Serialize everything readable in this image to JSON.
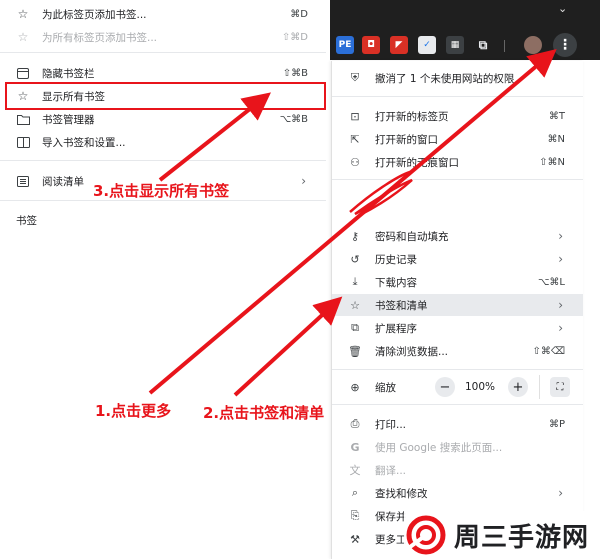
{
  "left_menu": {
    "items": [
      {
        "icon": "star-icon",
        "label": "为此标签页添加书签...",
        "shortcut": "⌘D",
        "disabled": false
      },
      {
        "icon": "star-icon",
        "label": "为所有标签页添加书签...",
        "shortcut": "⇧⌘D",
        "disabled": true
      },
      {
        "icon": "bookmark-bar-icon",
        "label": "隐藏书签栏",
        "shortcut": "⇧⌘B",
        "disabled": false
      },
      {
        "icon": "star-icon",
        "label": "显示所有书签",
        "shortcut": "",
        "disabled": false
      },
      {
        "icon": "folder-icon",
        "label": "书签管理器",
        "shortcut": "⌥⌘B",
        "disabled": false
      },
      {
        "icon": "import-icon",
        "label": "导入书签和设置...",
        "shortcut": "",
        "disabled": false
      },
      {
        "icon": "reading-list-icon",
        "label": "阅读清单",
        "shortcut": "",
        "disabled": false
      }
    ],
    "section_label": "书签"
  },
  "main_menu": {
    "notice": "撤消了 1 个未使用网站的权限",
    "new_items": [
      {
        "icon": "new-tab-icon",
        "label": "打开新的标签页",
        "shortcut": "⌘T"
      },
      {
        "icon": "new-window-icon",
        "label": "打开新的窗口",
        "shortcut": "⌘N"
      },
      {
        "icon": "incognito-icon",
        "label": "打开新的无痕窗口",
        "shortcut": "⇧⌘N"
      }
    ],
    "tool_items": [
      {
        "icon": "key-icon",
        "label": "密码和自动填充"
      },
      {
        "icon": "history-icon",
        "label": "历史记录"
      },
      {
        "icon": "download-icon",
        "label": "下载内容",
        "shortcut": "⌥⌘L"
      },
      {
        "icon": "star-icon",
        "label": "书签和清单"
      },
      {
        "icon": "puzzle-icon",
        "label": "扩展程序"
      },
      {
        "icon": "trash-icon",
        "label": "清除浏览数据...",
        "shortcut": "⇧⌘⌫"
      }
    ],
    "zoom": {
      "label": "缩放",
      "value": "100%"
    },
    "page_items": [
      {
        "icon": "print-icon",
        "label": "打印...",
        "shortcut": "⌘P",
        "disabled": false
      },
      {
        "icon": "google-icon",
        "label": "使用 Google 搜索此页面...",
        "disabled": true
      },
      {
        "icon": "translate-icon",
        "label": "翻译...",
        "disabled": true
      },
      {
        "icon": "find-icon",
        "label": "查找和修改",
        "disabled": false
      },
      {
        "icon": "save-icon",
        "label": "保存并",
        "disabled": false
      },
      {
        "icon": "more-tools-icon",
        "label": "更多工",
        "disabled": false
      }
    ]
  },
  "annotations": {
    "step1": "1.点击更多",
    "step2": "2.点击书签和清单",
    "step3": "3.点击显示所有书签"
  },
  "watermark": {
    "text": "周三手游网"
  },
  "colors": {
    "annotation_red": "#e8141b",
    "topbar": "#1f1f1f",
    "highlight": "#e8eaed"
  }
}
